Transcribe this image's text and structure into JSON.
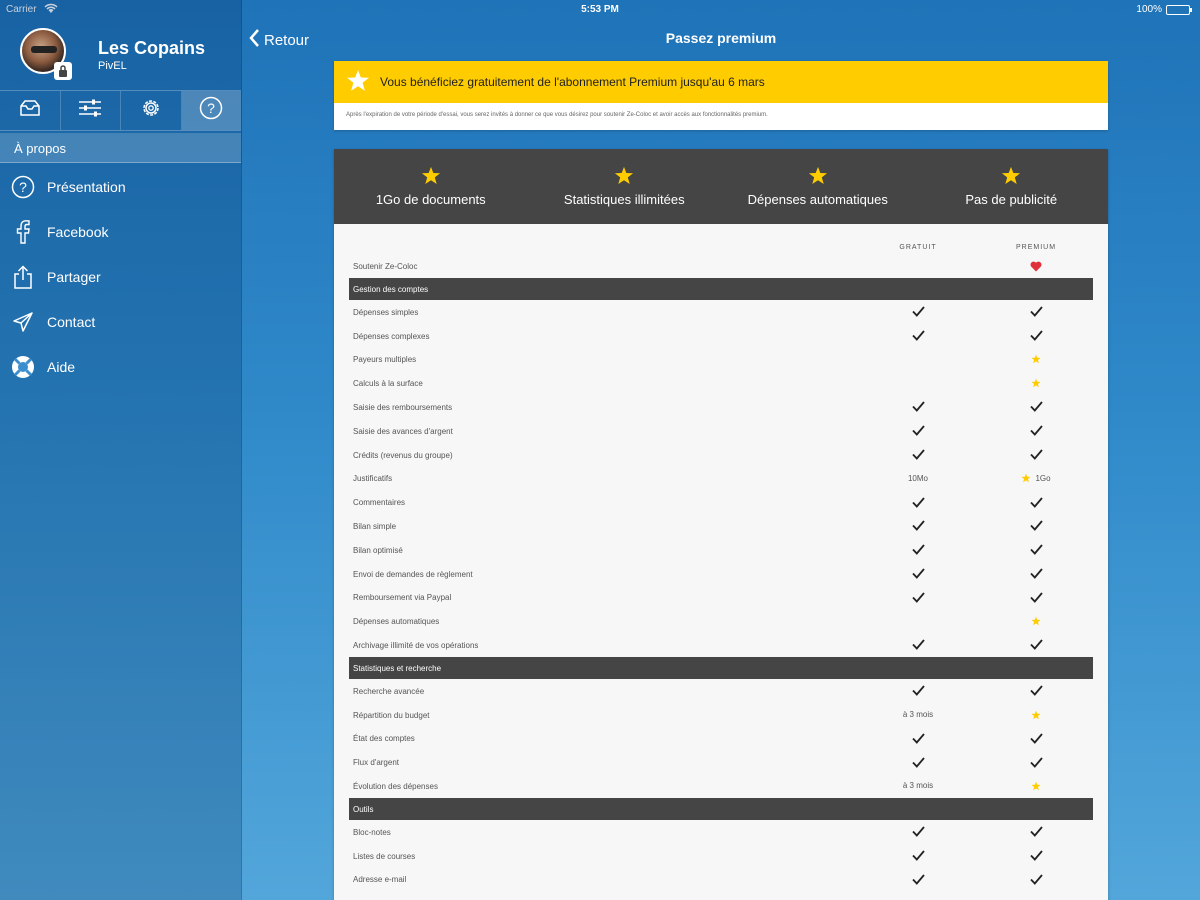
{
  "status": {
    "carrier": "Carrier",
    "time": "5:53 PM",
    "battery": "100%"
  },
  "sidebar": {
    "group_name": "Les Copains",
    "user_name": "PivEL",
    "section": "À propos",
    "items": [
      {
        "label": "Présentation",
        "icon": "help-circle-icon"
      },
      {
        "label": "Facebook",
        "icon": "facebook-icon"
      },
      {
        "label": "Partager",
        "icon": "share-icon"
      },
      {
        "label": "Contact",
        "icon": "paper-plane-icon"
      },
      {
        "label": "Aide",
        "icon": "lifebuoy-icon"
      }
    ]
  },
  "header": {
    "back": "Retour",
    "title": "Passez premium"
  },
  "trial": {
    "banner": "Vous bénéficiez gratuitement de l'abonnement Premium jusqu'au 6 mars",
    "note": "Après l'expiration de votre période d'essai, vous serez invités à donner ce que vous désirez pour soutenir Ze-Coloc et avoir accès aux fonctionnalités premium."
  },
  "features": [
    "1Go de documents",
    "Statistiques illimitées",
    "Dépenses automatiques",
    "Pas de publicité"
  ],
  "columns": {
    "free": "GRATUIT",
    "premium": "PREMIUM"
  },
  "support_row": {
    "label": "Soutenir Ze-Coloc"
  },
  "sections": [
    {
      "title": "Gestion des comptes",
      "rows": [
        {
          "label": "Dépenses simples",
          "free": "check",
          "premium": "check"
        },
        {
          "label": "Dépenses complexes",
          "free": "check",
          "premium": "check"
        },
        {
          "label": "Payeurs multiples",
          "free": "",
          "premium": "star"
        },
        {
          "label": "Calculs à la surface",
          "free": "",
          "premium": "star"
        },
        {
          "label": "Saisie des remboursements",
          "free": "check",
          "premium": "check"
        },
        {
          "label": "Saisie des avances d'argent",
          "free": "check",
          "premium": "check"
        },
        {
          "label": "Crédits (revenus du groupe)",
          "free": "check",
          "premium": "check"
        },
        {
          "label": "Justificatifs",
          "free": "10Mo",
          "premium": "star",
          "premium_text": "1Go"
        },
        {
          "label": "Commentaires",
          "free": "check",
          "premium": "check"
        },
        {
          "label": "Bilan simple",
          "free": "check",
          "premium": "check"
        },
        {
          "label": "Bilan optimisé",
          "free": "check",
          "premium": "check"
        },
        {
          "label": "Envoi de demandes de règlement",
          "free": "check",
          "premium": "check"
        },
        {
          "label": "Remboursement via Paypal",
          "free": "check",
          "premium": "check"
        },
        {
          "label": "Dépenses automatiques",
          "free": "",
          "premium": "star"
        },
        {
          "label": "Archivage illimité de vos opérations",
          "free": "check",
          "premium": "check"
        }
      ]
    },
    {
      "title": "Statistiques et recherche",
      "rows": [
        {
          "label": "Recherche avancée",
          "free": "check",
          "premium": "check"
        },
        {
          "label": "Répartition du budget",
          "free": "à 3 mois",
          "premium": "star"
        },
        {
          "label": "État des comptes",
          "free": "check",
          "premium": "check"
        },
        {
          "label": "Flux d'argent",
          "free": "check",
          "premium": "check"
        },
        {
          "label": "Évolution des dépenses",
          "free": "à 3 mois",
          "premium": "star"
        }
      ]
    },
    {
      "title": "Outils",
      "rows": [
        {
          "label": "Bloc-notes",
          "free": "check",
          "premium": "check"
        },
        {
          "label": "Listes de courses",
          "free": "check",
          "premium": "check"
        },
        {
          "label": "Adresse e-mail",
          "free": "check",
          "premium": "check"
        }
      ]
    }
  ],
  "colors": {
    "yellow": "#ffcc00",
    "dark": "#454545",
    "heart": "#e0303a"
  }
}
